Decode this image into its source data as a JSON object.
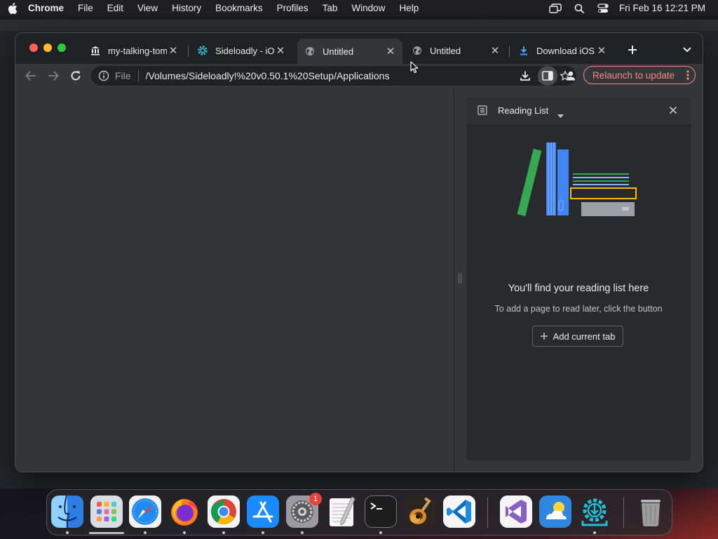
{
  "menubar": {
    "app_name": "Chrome",
    "items": [
      "File",
      "Edit",
      "View",
      "History",
      "Bookmarks",
      "Profiles",
      "Tab",
      "Window",
      "Help"
    ],
    "clock": "Fri Feb 16  12:21 PM"
  },
  "tabs": [
    {
      "title": "my-talking-tom",
      "icon": "museum-icon",
      "active": false
    },
    {
      "title": "Sideloadly - iOS",
      "icon": "sideloadly-gear-icon",
      "active": false
    },
    {
      "title": "Untitled",
      "icon": "globe-icon",
      "active": true
    },
    {
      "title": "Untitled",
      "icon": "globe-icon",
      "active": false
    },
    {
      "title": "Download iOS F",
      "icon": "download-arrow-icon",
      "active": false
    }
  ],
  "toolbar": {
    "scheme": "File",
    "url": "/Volumes/Sideloadly!%20v0.50.1%20Setup/Applications",
    "relaunch_label": "Relaunch to update"
  },
  "side_panel": {
    "title": "Reading List",
    "empty_title": "You'll find your reading list here",
    "empty_desc": "To add a page to read later, click the button",
    "add_label": "Add current tab"
  },
  "dock": {
    "apps": [
      "Finder",
      "Launchpad",
      "Safari",
      "Firefox",
      "Google Chrome",
      "App Store",
      "System Settings",
      "TextEdit",
      "Terminal",
      "GarageBand",
      "Visual Studio Code",
      "Visual Studio",
      "Weather",
      "Sideloadly",
      "Trash"
    ],
    "settings_badge": "1"
  },
  "colors": {
    "relaunch_accent": "#f28b82",
    "traffic_red": "#ff5f57",
    "traffic_yellow": "#febc2e",
    "traffic_green": "#28c840"
  }
}
